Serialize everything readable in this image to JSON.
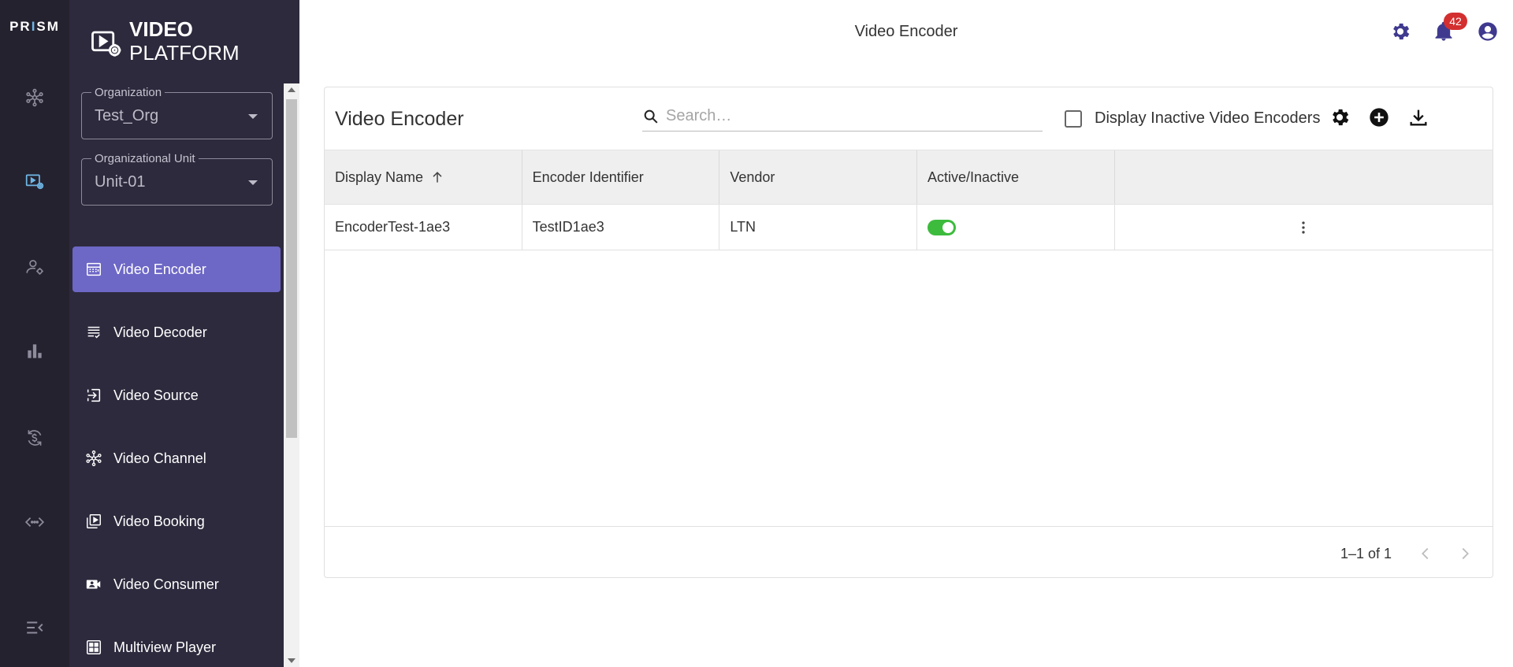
{
  "rail": {
    "brand_prefix": "PR",
    "brand_i": "I",
    "brand_suffix": "SM",
    "items": [
      {
        "name": "network-hub-icon"
      },
      {
        "name": "video-platform-icon"
      },
      {
        "name": "user-settings-icon"
      },
      {
        "name": "bar-chart-icon"
      },
      {
        "name": "dollar-sync-icon"
      },
      {
        "name": "code-arrows-icon"
      },
      {
        "name": "collapse-menu-icon"
      }
    ],
    "active_color": "#6fb7e6"
  },
  "sidebar": {
    "logo": {
      "line1": "VIDEO",
      "line2": "PLATFORM"
    },
    "organization": {
      "label": "Organization",
      "value": "Test_Org"
    },
    "org_unit": {
      "label": "Organizational Unit",
      "value": "Unit-01"
    },
    "items": [
      {
        "label": "Video Encoder",
        "icon": "encoder-icon",
        "active": true
      },
      {
        "label": "Video Decoder",
        "icon": "decoder-icon",
        "active": false
      },
      {
        "label": "Video Source",
        "icon": "source-icon",
        "active": false
      },
      {
        "label": "Video Channel",
        "icon": "channel-icon",
        "active": false
      },
      {
        "label": "Video Booking",
        "icon": "booking-icon",
        "active": false
      },
      {
        "label": "Video Consumer",
        "icon": "consumer-icon",
        "active": false
      },
      {
        "label": "Multiview Player",
        "icon": "multiview-icon",
        "active": false
      }
    ],
    "accent": "#6d67c6"
  },
  "header": {
    "title": "Video Encoder",
    "notifications_count": "42"
  },
  "card": {
    "title": "Video Encoder",
    "search_placeholder": "Search…",
    "inactive_checkbox_label": "Display Inactive Video Encoders",
    "columns": [
      "Display Name",
      "Encoder Identifier",
      "Vendor",
      "Active/Inactive",
      ""
    ],
    "rows": [
      {
        "display_name": "EncoderTest-1ae3",
        "encoder_identifier": "TestID1ae3",
        "vendor": "LTN",
        "active": true
      }
    ],
    "pagination": "1–1 of 1",
    "toggle_color": "#3dbb3d"
  }
}
